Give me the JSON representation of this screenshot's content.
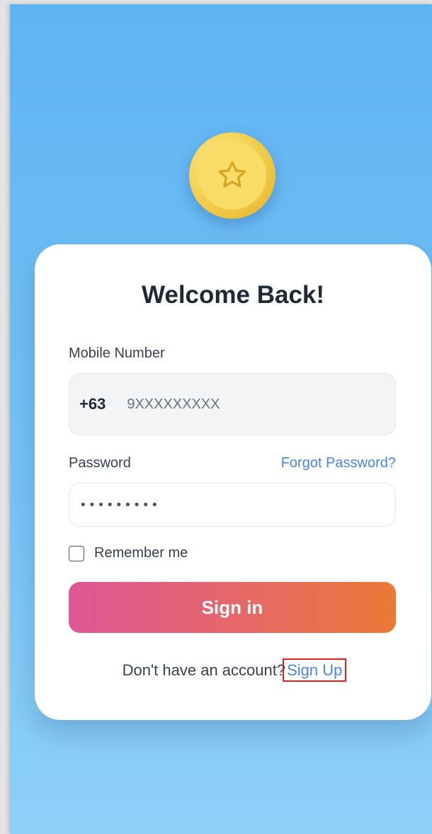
{
  "logo": {
    "icon": "star-icon",
    "color": "#f1cc4a"
  },
  "card": {
    "title": "Welcome Back!",
    "mobile": {
      "label": "Mobile Number",
      "prefix": "+63",
      "placeholder": "9XXXXXXXXX"
    },
    "password": {
      "label": "Password",
      "forgot_label": "Forgot Password?",
      "value": "•••••••••"
    },
    "remember_label": "Remember me",
    "remember_checked": false,
    "signin_label": "Sign in",
    "signup_prompt": "Don't have an account?",
    "signup_label": "Sign Up"
  },
  "colors": {
    "accent": "#4a85e4",
    "button_gradient_start": "#dd5895",
    "button_gradient_end": "#ea7a36",
    "background": "#5fb4f2"
  }
}
